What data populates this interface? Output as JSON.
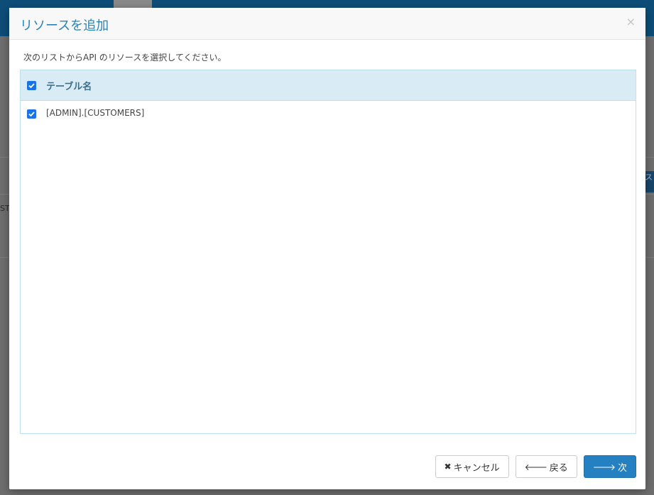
{
  "dialog": {
    "title": "リソースを追加",
    "close_glyph": "×",
    "instruction": "次のリストからAPI のリソースを選択してください。"
  },
  "table": {
    "header_label": "テーブル名",
    "header_checked": true,
    "rows": [
      {
        "name": "[ADMIN].[CUSTOMERS]",
        "checked": true
      }
    ]
  },
  "footer": {
    "cancel_label": "キャンセル",
    "back_label": "戻る",
    "next_label": "次"
  },
  "background": {
    "left_text": "ST",
    "right_text": "ス"
  },
  "colors": {
    "accent": "#2a82b7",
    "primary_button": "#2480c0",
    "table_header_bg": "#d9ecf5",
    "checkbox": "#1a73e8"
  }
}
